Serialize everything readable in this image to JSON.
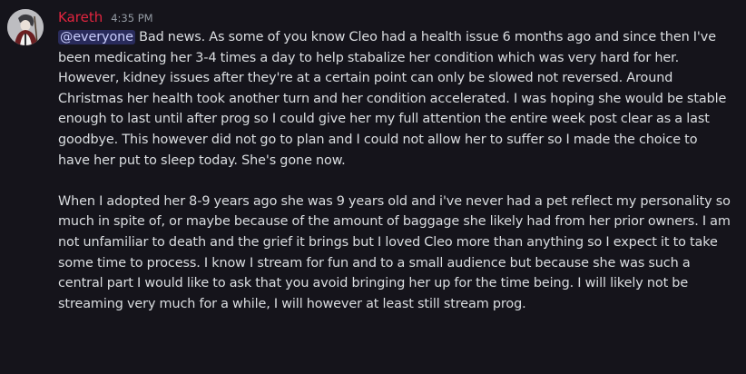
{
  "message": {
    "author": "Kareth",
    "author_color": "#e2253f",
    "timestamp": "4:35 PM",
    "avatar_icon": "user-avatar-icon",
    "mention": "@everyone",
    "paragraph1": " Bad news. As some of you know Cleo had a health issue 6 months ago and since then I've been medicating her 3-4 times a day to help stabalize her condition which was very hard for her. However, kidney issues after they're at a certain point can only be slowed not reversed. Around Christmas her health took another turn and her condition accelerated. I was hoping she would be stable enough to last until after prog so I could give her my full attention the entire week post clear as a last goodbye. This however did not go to plan and I could not allow her to suffer so I made the choice to have her put to sleep today. She's gone now.",
    "paragraph2": "When I adopted her 8-9 years ago she was 9 years old and i've never had a pet reflect my personality so much in spite of, or maybe because of the amount of baggage she likely had from her prior owners. I am not unfamiliar to death and the grief it brings but I loved Cleo more than anything so I expect it to take some time to process. I know I stream for fun and to a small audience but because she was such a central part I would like to ask that you avoid bringing her up for the time being. I will likely not be streaming very much for a while, I will however at least still stream prog."
  },
  "colors": {
    "background": "#15141b",
    "text": "#dbdee1",
    "timestamp": "#949ba4",
    "mention_bg": "rgba(88,101,242,0.3)",
    "mention_text": "#c9cdfb"
  }
}
